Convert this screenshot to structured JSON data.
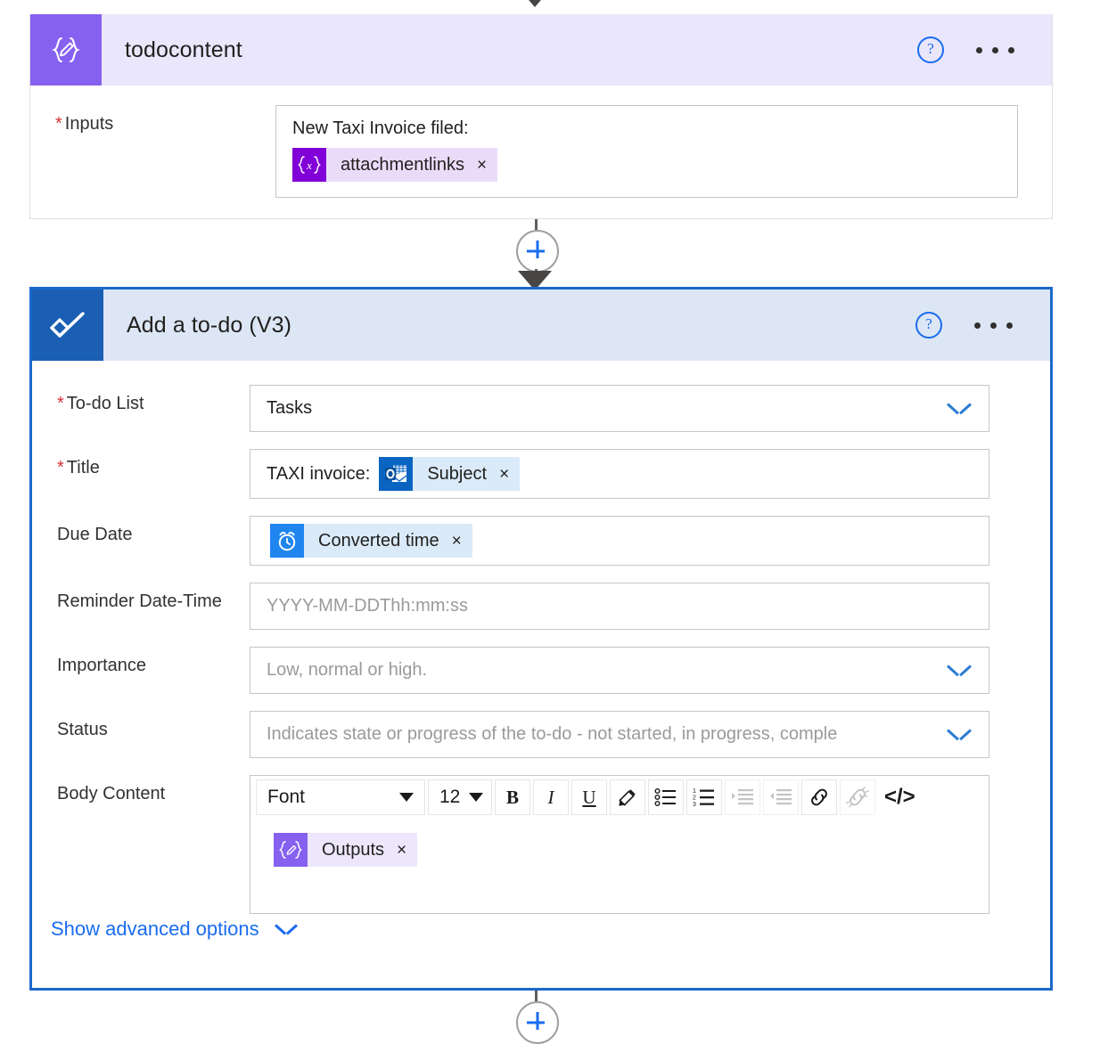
{
  "cards": {
    "todocontent": {
      "title": "todocontent",
      "icon": "compose-expression-icon",
      "help_label": "?",
      "menu_label": "...",
      "inputs": {
        "label": "Inputs",
        "required": true,
        "text_prefix": "New Taxi  Invoice filed:",
        "token": {
          "label": "attachmentlinks",
          "icon": "{x}",
          "remove": "×"
        }
      }
    },
    "add_todo": {
      "title": "Add a to-do (V3)",
      "icon": "check-mark-icon",
      "help_label": "?",
      "menu_label": "...",
      "fields": {
        "todo_list": {
          "label": "To-do List",
          "required": true,
          "value": "Tasks",
          "chevron": "chevron-down"
        },
        "title": {
          "label": "Title",
          "required": true,
          "text_prefix": "TAXI invoice:",
          "token": {
            "label": "Subject",
            "icon": "outlook-icon",
            "remove": "×"
          }
        },
        "due_date": {
          "label": "Due Date",
          "required": false,
          "token": {
            "label": "Converted time",
            "icon": "alarm-clock-icon",
            "remove": "×"
          }
        },
        "reminder": {
          "label": "Reminder Date-Time",
          "required": false,
          "placeholder": "YYYY-MM-DDThh:mm:ss"
        },
        "importance": {
          "label": "Importance",
          "required": false,
          "placeholder": "Low, normal or high.",
          "chevron": "chevron-down"
        },
        "status": {
          "label": "Status",
          "required": false,
          "placeholder": "Indicates state or progress of the to-do - not started, in progress, comple",
          "chevron": "chevron-down"
        },
        "body_content": {
          "label": "Body Content",
          "required": false,
          "toolbar": {
            "font_name": "Font",
            "font_size": "12",
            "bold": "B",
            "italic": "I",
            "underline": "U",
            "text_color": "pen-icon",
            "bullet_list": "bulleted-list-icon",
            "number_list": "numbered-list-icon",
            "indent": "increase-indent-icon",
            "outdent": "decrease-indent-icon",
            "link": "link-icon",
            "unlink": "unlink-icon",
            "code": "</>"
          },
          "token": {
            "label": "Outputs",
            "icon": "compose-expression-icon",
            "remove": "×"
          }
        }
      },
      "advanced_link": "Show advanced options"
    }
  },
  "connectors": {
    "add_step_label": "+"
  },
  "colors": {
    "purple_header": "#eae6fb",
    "purple_icon": "#8661f0",
    "blue_header": "#dce6f4",
    "blue_icon": "#1a5fb4",
    "selected_border": "#1a69c9",
    "accent_link": "#1a6cf0",
    "required_star": "#d13438",
    "token_purple": "#8000d7",
    "token_blue": "#0a64c2",
    "token_lightblue": "#1f86f0"
  }
}
